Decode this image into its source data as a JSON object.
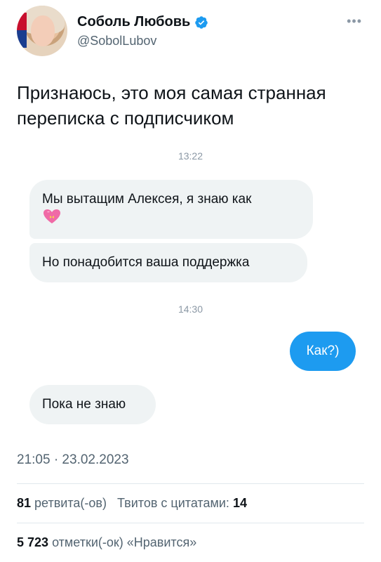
{
  "author": {
    "name": "Соболь Любовь",
    "handle": "@SobolLubov",
    "verified": true
  },
  "more_icon": "ellipsis-icon",
  "tweet_text": "Признаюсь, это моя самая странная переписка с подписчиком",
  "conversation": {
    "time1": "13:22",
    "msg1": "Мы вытащим Алексея, я знаю как",
    "msg1_emoji": "heart-with-ribbon-emoji",
    "msg2": "Но понадобится ваша поддержка",
    "time2": "14:30",
    "msg3": "Как?)",
    "msg4": "Пока не знаю"
  },
  "meta": "21:05 · 23.02.2023",
  "stats": {
    "retweets_count": "81",
    "retweets_label": "ретвита(-ов)",
    "quotes_label": "Твитов с цитатами:",
    "quotes_count": "14",
    "likes_count": "5 723",
    "likes_label": "отметки(-ок) «Нравится»"
  },
  "colors": {
    "accent": "#1d9bf0",
    "bubble_gray": "#eff3f4",
    "text_secondary": "#536471"
  }
}
